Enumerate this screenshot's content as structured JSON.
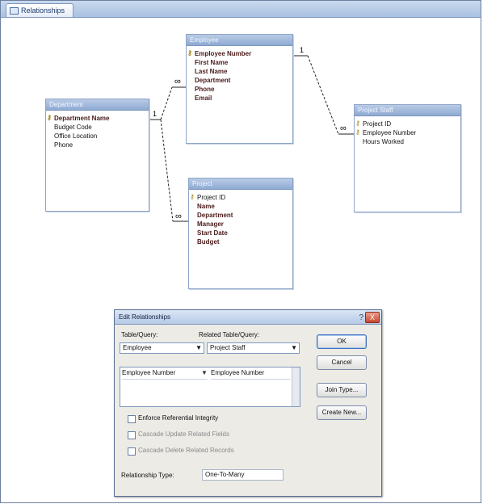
{
  "window": {
    "tab_label": "Relationships"
  },
  "tables": {
    "employee": {
      "title": "Employee",
      "fields": [
        {
          "name": "Employee Number",
          "pk": true,
          "bold": true
        },
        {
          "name": "First Name",
          "bold": true
        },
        {
          "name": "Last Name",
          "bold": true
        },
        {
          "name": "Department",
          "bold": true
        },
        {
          "name": "Phone",
          "bold": true
        },
        {
          "name": "Email",
          "bold": true
        }
      ]
    },
    "department": {
      "title": "Department",
      "fields": [
        {
          "name": "Department Name",
          "pk": true,
          "bold": true
        },
        {
          "name": "Budget Code",
          "bold": false
        },
        {
          "name": "Office Location",
          "bold": false
        },
        {
          "name": "Phone",
          "bold": false
        }
      ]
    },
    "project_staff": {
      "title": "Project Staff",
      "fields": [
        {
          "name": "Project ID",
          "pk": true
        },
        {
          "name": "Employee Number",
          "pk": true
        },
        {
          "name": "Hours Worked",
          "pk": false
        }
      ]
    },
    "project": {
      "title": "Project",
      "fields": [
        {
          "name": "Project ID",
          "pk": true,
          "bold": false
        },
        {
          "name": "Name",
          "bold": true
        },
        {
          "name": "Department",
          "bold": true
        },
        {
          "name": "Manager",
          "bold": true
        },
        {
          "name": "Start Date",
          "bold": true
        },
        {
          "name": "Budget",
          "bold": true
        }
      ]
    }
  },
  "relationships": [
    {
      "from": "department",
      "to": "employee",
      "one": "1",
      "many": "∞"
    },
    {
      "from": "department",
      "to": "project",
      "one": "1",
      "many": "∞"
    },
    {
      "from": "employee",
      "to": "project_staff",
      "one": "1",
      "many": "∞"
    }
  ],
  "dialog": {
    "title": "Edit Relationships",
    "help": "?",
    "close": "X",
    "table_label": "Table/Query:",
    "related_label": "Related Table/Query:",
    "table_value": "Employee",
    "related_value": "Project Staff",
    "grid_left": "Employee Number",
    "grid_right": "Employee Number",
    "buttons": {
      "ok": "OK",
      "cancel": "Cancel",
      "join": "Join Type...",
      "create_new": "Create New..."
    },
    "checks": {
      "enforce": "Enforce Referential Integrity",
      "cascade_update": "Cascade Update Related Fields",
      "cascade_delete": "Cascade Delete Related Records"
    },
    "relationship_type_label": "Relationship Type:",
    "relationship_type_value": "One-To-Many"
  }
}
